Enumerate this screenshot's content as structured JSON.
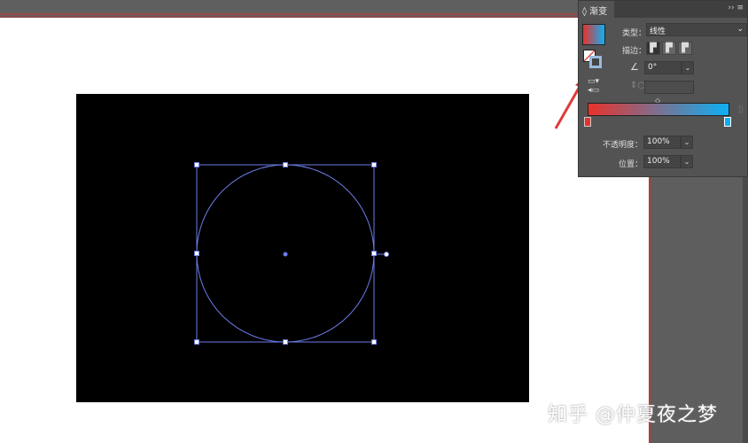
{
  "panel": {
    "tab_label": "渐变",
    "menu_icons": [
      "expand-icon",
      "menu-icon"
    ],
    "type_label": "类型：",
    "type_value": "线性",
    "stroke_label": "描边：",
    "angle_value": "0°",
    "opacity_label": "不透明度：",
    "opacity_value": "100%",
    "position_label": "位置：",
    "position_value": "100%",
    "gradient": {
      "start_color": "#e8322c",
      "end_color": "#0db0f5"
    }
  },
  "watermark": "知乎 @仲夏夜之梦"
}
